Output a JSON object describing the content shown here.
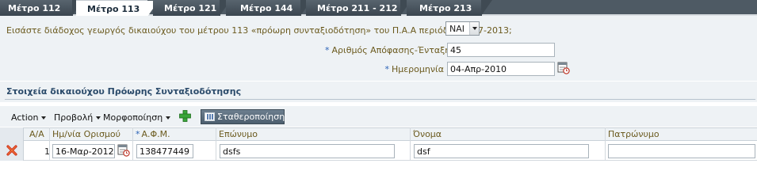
{
  "tabs": [
    {
      "label": "Μέτρο 112",
      "active": false
    },
    {
      "label": "Μέτρο 113",
      "active": true
    },
    {
      "label": "Μέτρο 121",
      "active": false
    },
    {
      "label": "Μέτρο 144",
      "active": false
    },
    {
      "label": "Μέτρο 211 - 212",
      "active": false
    },
    {
      "label": "Μέτρο 213",
      "active": false
    }
  ],
  "form": {
    "question_label": "Εισάστε διάδοχος γεωργός δικαιούχου του μέτρου 113 «πρόωρη συνταξιοδότηση» του Π.Α.Α περιόδου 2007-2013;",
    "question_value": "ΝΑΙ",
    "required_mark": "*",
    "decision_label": "Αριθμός Απόφασης-Ένταξης",
    "decision_value": "45",
    "date_label": "Ημερομηνία",
    "date_value": "04-Απρ-2010"
  },
  "section": {
    "title": "Στοιχεία δικαιούχου Πρόωρης Συνταξιοδότησης"
  },
  "toolbar": {
    "action_label": "Action",
    "view_label": "Προβολή",
    "format_label": "Μορφοποίηση",
    "freeze_label": "Σταθεροποίηση"
  },
  "table": {
    "columns": [
      "Α/Α",
      "Ημ/νία Ορισμού",
      "Α.Φ.Μ.",
      "Επώνυμο",
      "Όνομα",
      "Πατρώνυμο"
    ],
    "afm_required_mark": "*",
    "rows": [
      {
        "aa": "1",
        "date": "16-Μαρ-2012",
        "afm": "138477449",
        "surname": "dsfs",
        "name": "dsf",
        "father": ""
      }
    ]
  },
  "colors": {
    "tab_bar": "#4e5a64",
    "label_text": "#6b5a1e",
    "required_star": "#2c63b7",
    "section_title": "#2a4a6a",
    "panel_bg": "#eef2f5"
  }
}
